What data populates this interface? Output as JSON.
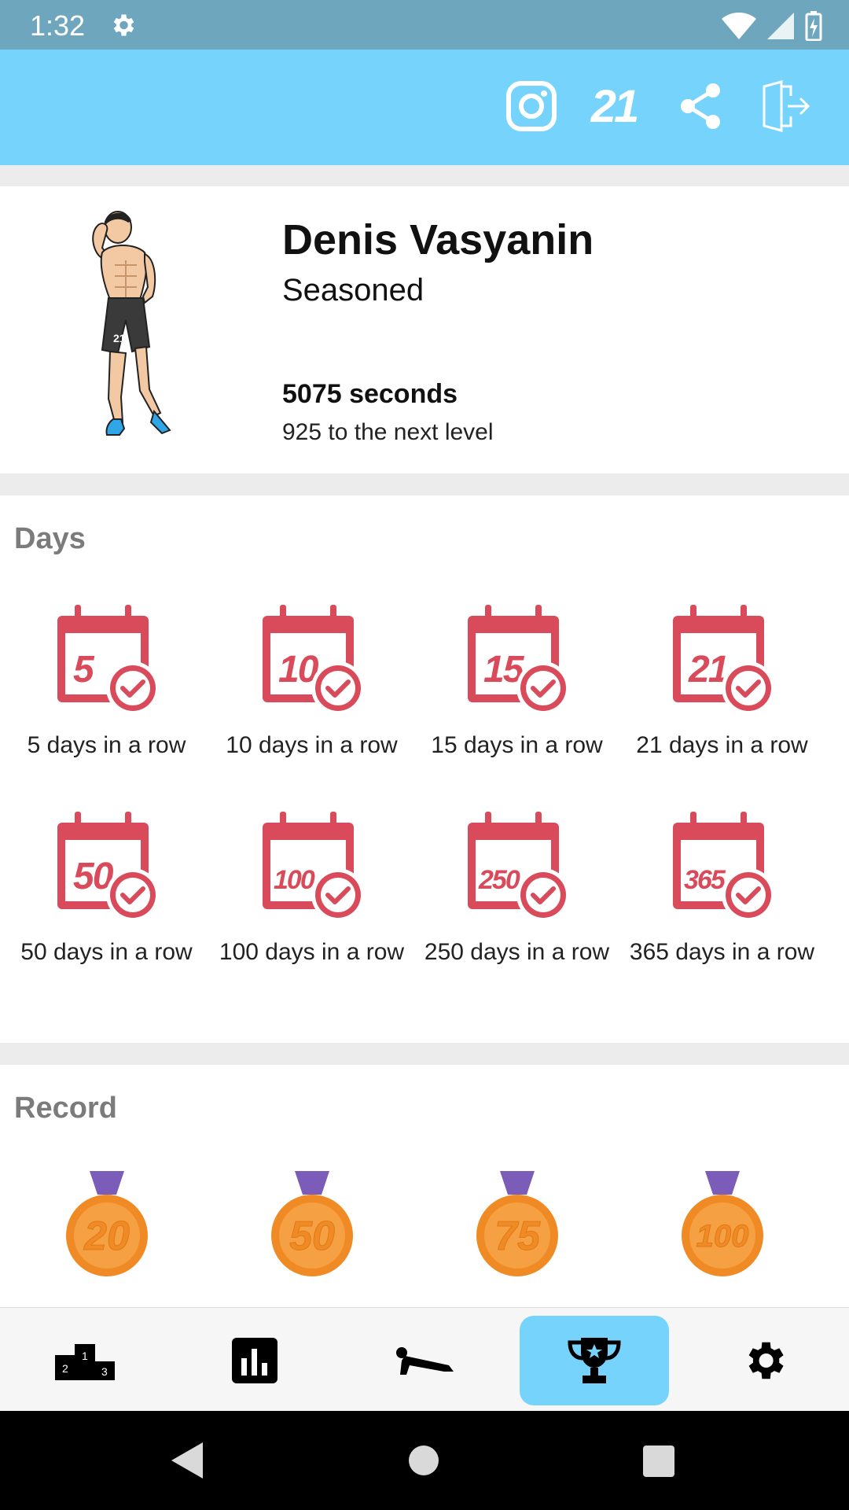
{
  "status_bar": {
    "time": "1:32",
    "icons": [
      "settings-icon",
      "wifi-icon",
      "signal-icon",
      "battery-icon"
    ]
  },
  "app_bar": {
    "actions": [
      {
        "name": "instagram-button",
        "icon": "instagram-icon"
      },
      {
        "name": "app-21-button",
        "icon": "21-logo-icon",
        "text": "21"
      },
      {
        "name": "share-button",
        "icon": "share-icon"
      },
      {
        "name": "logout-button",
        "icon": "exit-door-icon"
      }
    ]
  },
  "profile": {
    "name": "Denis Vasyanin",
    "rank": "Seasoned",
    "seconds": "5075 seconds",
    "next_level": "925 to the next level",
    "avatar_number": "21"
  },
  "days_section": {
    "title": "Days",
    "items": [
      {
        "badge": "5",
        "label": "5 days in a row"
      },
      {
        "badge": "10",
        "label": "10 days in a row"
      },
      {
        "badge": "15",
        "label": "15 days in a row"
      },
      {
        "badge": "21",
        "label": "21 days in a row"
      },
      {
        "badge": "50",
        "label": "50 days in a row"
      },
      {
        "badge": "100",
        "label": "100 days in a row"
      },
      {
        "badge": "250",
        "label": "250 days in a row"
      },
      {
        "badge": "365",
        "label": "365 days in a row"
      }
    ]
  },
  "record_section": {
    "title": "Record",
    "items": [
      {
        "badge": "20"
      },
      {
        "badge": "50"
      },
      {
        "badge": "75"
      },
      {
        "badge": "100"
      }
    ]
  },
  "bottom_nav": {
    "items": [
      {
        "name": "nav-leaderboard",
        "icon": "podium-icon"
      },
      {
        "name": "nav-statistics",
        "icon": "bar-chart-icon"
      },
      {
        "name": "nav-workout",
        "icon": "plank-icon"
      },
      {
        "name": "nav-achievements",
        "icon": "trophy-icon",
        "active": true
      },
      {
        "name": "nav-settings",
        "icon": "gear-icon"
      }
    ]
  },
  "colors": {
    "app_bar": "#76d4fc",
    "status_bar": "#6ea7bd",
    "calendar_red": "#d94b5a",
    "medal_orange": "#f08a24",
    "ribbon_purple": "#7b5cb8"
  }
}
